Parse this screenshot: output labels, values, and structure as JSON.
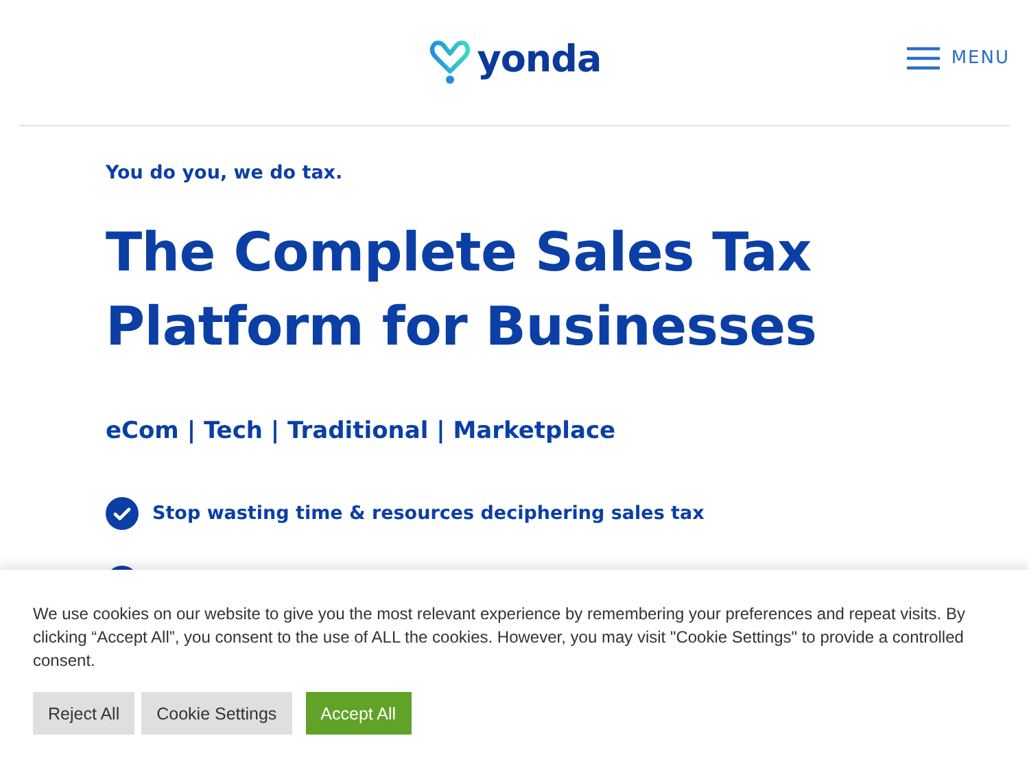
{
  "header": {
    "logo_text": "yonda",
    "menu_label": "MENU"
  },
  "hero": {
    "tagline": "You do you, we do tax.",
    "heading_lines": [
      "The Complete Sales Tax",
      "Platform for Businesses"
    ],
    "segments": "eCom | Tech | Traditional | Marketplace",
    "features": [
      "Stop wasting time & resources deciphering sales tax"
    ]
  },
  "cookie_banner": {
    "text": "We use cookies on our website to give you the most relevant experience by remembering your preferences and repeat visits. By clicking “Accept All”, you consent to the use of ALL the cookies. However, you may visit \"Cookie Settings\" to provide a controlled consent.",
    "buttons": [
      {
        "label": "Reject All",
        "kind": "secondary"
      },
      {
        "label": "Cookie Settings",
        "kind": "secondary"
      },
      {
        "label": "Accept All",
        "kind": "primary"
      }
    ]
  }
}
